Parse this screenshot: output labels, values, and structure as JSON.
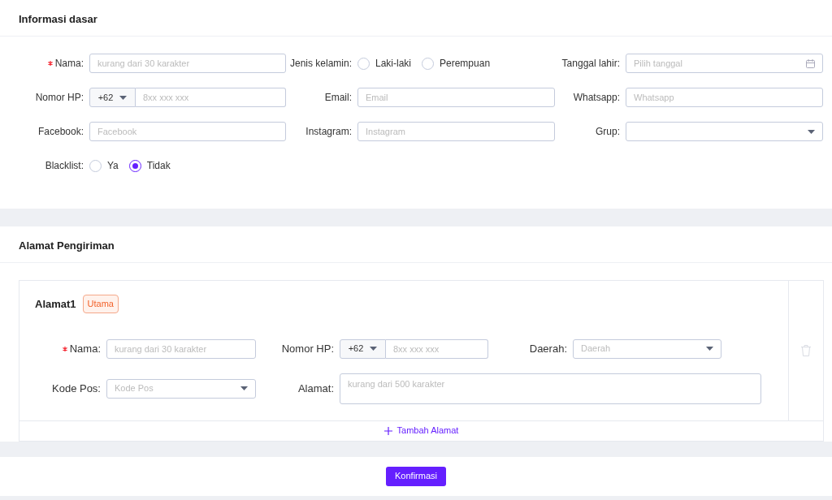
{
  "basic_info": {
    "title": "Informasi dasar",
    "fields": [
      {
        "kind": "text",
        "label": "Nama:",
        "required": true,
        "placeholder": "kurang dari 30 karakter"
      },
      {
        "kind": "radio",
        "label": "Jenis kelamin:",
        "required": false,
        "options": [
          {
            "label": "Laki-laki",
            "selected": false
          },
          {
            "label": "Perempuan",
            "selected": false
          }
        ]
      },
      {
        "kind": "date",
        "label": "Tanggal lahir:",
        "required": false,
        "placeholder": "Pilih tanggal"
      },
      {
        "kind": "phone",
        "label": "Nomor HP:",
        "required": false,
        "code": "+62",
        "placeholder": "8xx xxx xxx"
      },
      {
        "kind": "text",
        "label": "Email:",
        "required": false,
        "placeholder": "Email"
      },
      {
        "kind": "text",
        "label": "Whatsapp:",
        "required": false,
        "placeholder": "Whatsapp"
      },
      {
        "kind": "text",
        "label": "Facebook:",
        "required": false,
        "placeholder": "Facebook"
      },
      {
        "kind": "text",
        "label": "Instagram:",
        "required": false,
        "placeholder": "Instagram"
      },
      {
        "kind": "select",
        "label": "Grup:",
        "required": false
      },
      {
        "kind": "radio",
        "label": "Blacklist:",
        "required": false,
        "options": [
          {
            "label": "Ya",
            "selected": false
          },
          {
            "label": "Tidak",
            "selected": true
          }
        ]
      }
    ]
  },
  "shipping": {
    "title": "Alamat Pengiriman",
    "addresses": [
      {
        "title": "Alamat1",
        "badge": "Utama",
        "fields": [
          {
            "kind": "text",
            "label": "Nama:",
            "required": true,
            "placeholder": "kurang dari 30 karakter"
          },
          {
            "kind": "phone",
            "label": "Nomor HP:",
            "required": false,
            "code": "+62",
            "placeholder": "8xx xxx xxx"
          },
          {
            "kind": "select",
            "label": "Daerah:",
            "required": false,
            "placeholder": "Daerah"
          },
          {
            "kind": "select",
            "label": "Kode Pos:",
            "required": false,
            "placeholder": "Kode Pos"
          },
          {
            "kind": "textarea",
            "label": "Alamat:",
            "required": false,
            "placeholder": "kurang dari 500 karakter"
          }
        ]
      }
    ],
    "add_label": "Tambah Alamat"
  },
  "confirm_label": "Konfirmasi"
}
